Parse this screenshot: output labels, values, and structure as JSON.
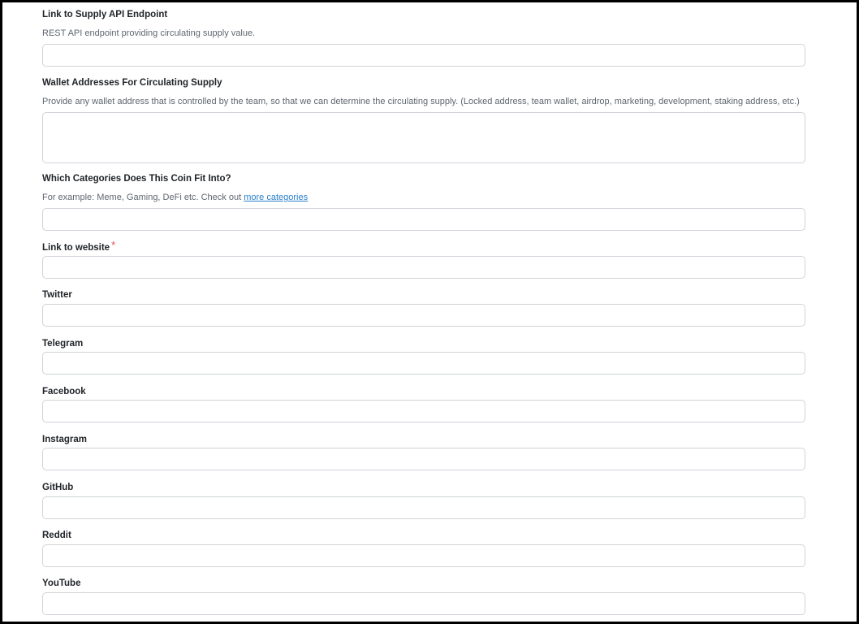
{
  "fields": {
    "supply_api": {
      "label": "Link to Supply API Endpoint",
      "help": "REST API endpoint providing circulating supply value.",
      "value": ""
    },
    "wallet_addresses": {
      "label": "Wallet Addresses For Circulating Supply",
      "help": "Provide any wallet address that is controlled by the team, so that we can determine the circulating supply. (Locked address, team wallet, airdrop, marketing, development, staking address, etc.)",
      "value": ""
    },
    "categories": {
      "label": "Which Categories Does This Coin Fit Into?",
      "help_prefix": "For example: Meme, Gaming, DeFi etc. Check out ",
      "help_link": "more categories",
      "value": ""
    },
    "website": {
      "label": "Link to website",
      "required_mark": "*",
      "value": ""
    },
    "twitter": {
      "label": "Twitter",
      "value": ""
    },
    "telegram": {
      "label": "Telegram",
      "value": ""
    },
    "facebook": {
      "label": "Facebook",
      "value": ""
    },
    "instagram": {
      "label": "Instagram",
      "value": ""
    },
    "github": {
      "label": "GitHub",
      "value": ""
    },
    "reddit": {
      "label": "Reddit",
      "value": ""
    },
    "youtube": {
      "label": "YouTube",
      "value": ""
    }
  },
  "colors": {
    "required": "#d9534f",
    "link": "#2a7ec9",
    "border": "#cfd3d8"
  }
}
